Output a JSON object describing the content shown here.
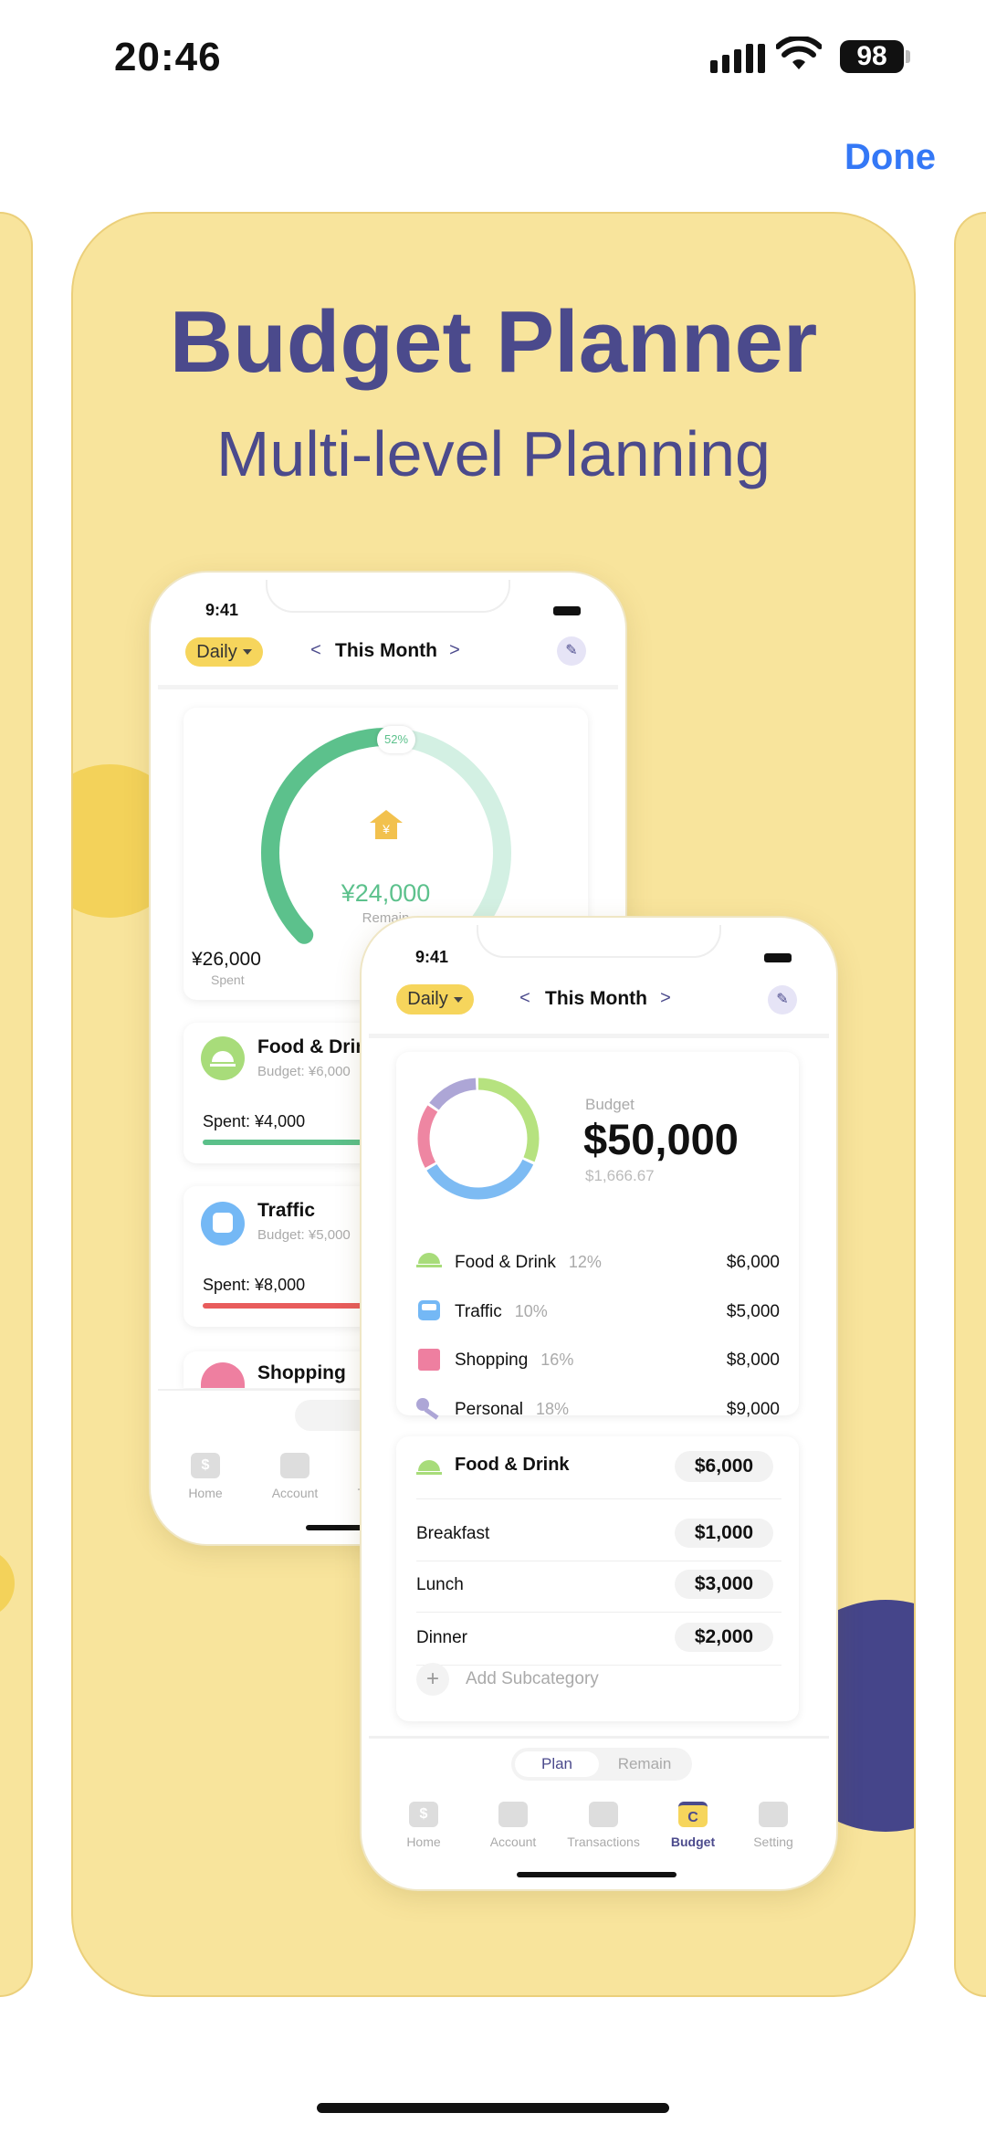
{
  "status_bar": {
    "time": "20:46",
    "battery": "98"
  },
  "header": {
    "done_label": "Done"
  },
  "card": {
    "title": "Budget Planner",
    "subtitle": "Multi-level Planning"
  },
  "colors": {
    "card_bg": "#F8E49C",
    "title": "#4B4A8C",
    "accent_blue": "#3478F6",
    "yellow": "#F6D55C",
    "navy": "#45458A"
  },
  "phone_back": {
    "time": "9:41",
    "period": "Daily",
    "month": "This Month",
    "prev": "<",
    "next": ">",
    "gauge": {
      "percent_label": "52%",
      "percent": 52,
      "remain_amount": "¥24,000",
      "remain_label": "Remain",
      "spent_amount": "¥26,000",
      "spent_label": "Spent"
    },
    "categories": [
      {
        "name": "Food & Drink",
        "budget": "Budget: ¥6,000",
        "spent": "Spent: ¥4,000",
        "color": "#A8DC7A",
        "bar_color": "#5BC08A"
      },
      {
        "name": "Traffic",
        "budget": "Budget: ¥5,000",
        "spent": "Spent: ¥8,000",
        "color": "#74B8F5",
        "bar_color": "#E85C5C"
      },
      {
        "name": "Shopping",
        "color": "#EE7FA0"
      }
    ],
    "toggle": "Plan",
    "nav": [
      "Home",
      "Account",
      "Tr"
    ]
  },
  "phone_front": {
    "time": "9:41",
    "period": "Daily",
    "month": "This Month",
    "prev": "<",
    "next": ">",
    "budget_label": "Budget",
    "budget_amount": "$50,000",
    "daily_amount": "$1,666.67",
    "donut": [
      {
        "color": "#B6E27F",
        "share": 0.32
      },
      {
        "color": "#7DBBF3",
        "share": 0.35
      },
      {
        "color": "#EE86A2",
        "share": 0.18
      },
      {
        "color": "#ADA6D6",
        "share": 0.15
      }
    ],
    "rows": [
      {
        "name": "Food & Drink",
        "pct": "12%",
        "amount": "$6,000",
        "icon": "cloche-icon",
        "color": "#A8DC7A"
      },
      {
        "name": "Traffic",
        "pct": "10%",
        "amount": "$5,000",
        "icon": "bus-icon",
        "color": "#74B8F5"
      },
      {
        "name": "Shopping",
        "pct": "16%",
        "amount": "$8,000",
        "icon": "bag-icon",
        "color": "#EE7FA0"
      },
      {
        "name": "Personal",
        "pct": "18%",
        "amount": "$9,000",
        "icon": "microphone-icon",
        "color": "#ADA6D6"
      }
    ],
    "detail": {
      "name": "Food & Drink",
      "amount": "$6,000",
      "subs": [
        {
          "name": "Breakfast",
          "amount": "$1,000"
        },
        {
          "name": "Lunch",
          "amount": "$3,000"
        },
        {
          "name": "Dinner",
          "amount": "$2,000"
        }
      ],
      "add_label": "Add Subcategory"
    },
    "toggle": {
      "plan": "Plan",
      "remain": "Remain"
    },
    "nav": [
      {
        "label": "Home"
      },
      {
        "label": "Account"
      },
      {
        "label": "Transactions"
      },
      {
        "label": "Budget",
        "active": true
      },
      {
        "label": "Setting"
      }
    ]
  }
}
